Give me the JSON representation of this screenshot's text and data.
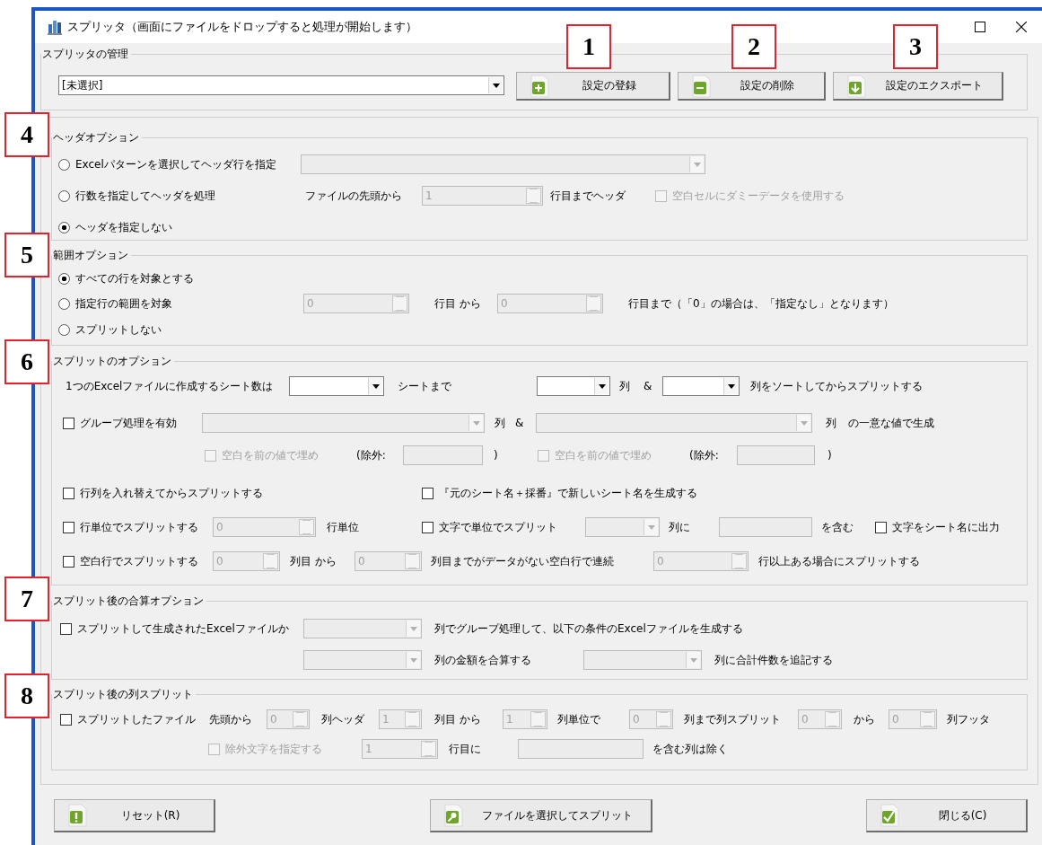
{
  "window": {
    "title": "スプリッタ（画面にファイルをドロップすると処理が開始します）"
  },
  "management": {
    "legend": "スプリッタの管理",
    "combo": {
      "value": "[未選択]"
    },
    "buttons": [
      {
        "label": "設定の登録"
      },
      {
        "label": "設定の削除"
      },
      {
        "label": "設定のエクスポート"
      }
    ]
  },
  "sections": [
    {
      "legend": "ヘッダオプション",
      "rows": [
        {
          "items": [
            {
              "kind": "radio",
              "label": "Excelパターンを選択してヘッダ行を指定",
              "selected": false
            },
            {
              "kind": "combo",
              "disabled": true
            }
          ]
        },
        {
          "items": [
            {
              "kind": "radio",
              "label": "行数を指定してヘッダを処理",
              "selected": false
            },
            {
              "kind": "label",
              "text": "ファイルの先頭から"
            },
            {
              "kind": "spin",
              "value": "1",
              "disabled": true
            },
            {
              "kind": "label",
              "text": "行目までヘッダ"
            },
            {
              "kind": "checkbox",
              "label": "空白セルにダミーデータを使用する",
              "checked": false,
              "disabled": true
            }
          ]
        },
        {
          "items": [
            {
              "kind": "radio",
              "label": "ヘッダを指定しない",
              "selected": true
            }
          ]
        }
      ]
    },
    {
      "legend": "範囲オプション",
      "rows": [
        {
          "items": [
            {
              "kind": "radio",
              "label": "すべての行を対象とする",
              "selected": true
            }
          ]
        },
        {
          "items": [
            {
              "kind": "radio",
              "label": "指定行の範囲を対象",
              "selected": false
            },
            {
              "kind": "spin",
              "value": "0",
              "disabled": true
            },
            {
              "kind": "label",
              "text": "行目 から"
            },
            {
              "kind": "spin",
              "value": "0",
              "disabled": true
            },
            {
              "kind": "label",
              "text": "行目まで（「0」の場合は、「指定なし」となります）"
            }
          ]
        },
        {
          "items": [
            {
              "kind": "radio",
              "label": "スプリットしない",
              "selected": false
            }
          ]
        }
      ]
    },
    {
      "legend": "スプリットのオプション",
      "rows": [
        {
          "items": [
            {
              "kind": "label",
              "text": "1つのExcelファイルに作成するシート数は"
            },
            {
              "kind": "combo",
              "disabled": false
            },
            {
              "kind": "label",
              "text": "シートまで"
            },
            {
              "kind": "combo",
              "disabled": false
            },
            {
              "kind": "label",
              "text": "列"
            },
            {
              "kind": "label",
              "text": "&"
            },
            {
              "kind": "combo",
              "disabled": false
            },
            {
              "kind": "label",
              "text": "列をソートしてからスプリットする"
            }
          ]
        },
        {
          "items": [
            {
              "kind": "checkbox",
              "label": "グループ処理を有効",
              "checked": false,
              "disabled": false
            },
            {
              "kind": "combo",
              "disabled": true
            },
            {
              "kind": "label",
              "text": "列"
            },
            {
              "kind": "label",
              "text": "&"
            },
            {
              "kind": "combo",
              "disabled": true
            },
            {
              "kind": "label",
              "text": "列"
            },
            {
              "kind": "label",
              "text": "の一意な値で生成"
            }
          ]
        },
        {
          "items": [
            {
              "kind": "checkbox",
              "label": "空白を前の値で埋め",
              "checked": false,
              "disabled": true
            },
            {
              "kind": "label",
              "text": "(除外:"
            },
            {
              "kind": "textbox",
              "disabled": true
            },
            {
              "kind": "label",
              "text": ")"
            },
            {
              "kind": "checkbox",
              "label": "空白を前の値で埋め",
              "checked": false,
              "disabled": true
            },
            {
              "kind": "label",
              "text": "(除外:"
            },
            {
              "kind": "textbox",
              "disabled": true
            },
            {
              "kind": "label",
              "text": ")"
            }
          ]
        },
        {
          "items": [
            {
              "kind": "checkbox",
              "label": "行列を入れ替えてからスプリットする",
              "checked": false,
              "disabled": false
            },
            {
              "kind": "checkbox",
              "label": "『元のシート名＋採番』で新しいシート名を生成する",
              "checked": false,
              "disabled": false
            }
          ]
        },
        {
          "items": [
            {
              "kind": "checkbox",
              "label": "行単位でスプリットする",
              "checked": false,
              "disabled": false
            },
            {
              "kind": "spin",
              "value": "0",
              "disabled": true
            },
            {
              "kind": "label",
              "text": "行単位"
            },
            {
              "kind": "checkbox",
              "label": "文字で単位でスプリット",
              "checked": false,
              "disabled": false
            },
            {
              "kind": "combo",
              "disabled": true
            },
            {
              "kind": "label",
              "text": "列に"
            },
            {
              "kind": "textbox",
              "disabled": true
            },
            {
              "kind": "label",
              "text": "を含む"
            },
            {
              "kind": "checkbox",
              "label": "文字をシート名に出力",
              "checked": false,
              "disabled": false
            }
          ]
        },
        {
          "items": [
            {
              "kind": "checkbox",
              "label": "空白行でスプリットする",
              "checked": false,
              "disabled": false
            },
            {
              "kind": "spin",
              "value": "0",
              "disabled": true
            },
            {
              "kind": "label",
              "text": "列目 から"
            },
            {
              "kind": "spin",
              "value": "0",
              "disabled": true
            },
            {
              "kind": "label",
              "text": "列目までがデータがない空白行で連続"
            },
            {
              "kind": "spin",
              "value": "0",
              "disabled": true
            },
            {
              "kind": "label",
              "text": "行以上ある場合にスプリットする"
            }
          ]
        }
      ]
    },
    {
      "legend": "スプリット後の合算オプション",
      "rows": [
        {
          "items": [
            {
              "kind": "checkbox",
              "label": "スプリットして生成されたExcelファイルか",
              "checked": false,
              "disabled": false
            },
            {
              "kind": "combo",
              "disabled": true
            },
            {
              "kind": "label",
              "text": "列でグループ処理して、以下の条件のExcelファイルを生成する"
            }
          ]
        },
        {
          "items": [
            {
              "kind": "combo",
              "disabled": true
            },
            {
              "kind": "label",
              "text": "列の金額を合算する"
            },
            {
              "kind": "combo",
              "disabled": true
            },
            {
              "kind": "label",
              "text": "列に合計件数を追記する"
            }
          ]
        }
      ]
    },
    {
      "legend": "スプリット後の列スプリット",
      "rows": [
        {
          "items": [
            {
              "kind": "checkbox",
              "label": "スプリットしたファイル",
              "checked": false,
              "disabled": false
            },
            {
              "kind": "label",
              "text": "先頭から"
            },
            {
              "kind": "spin",
              "value": "0",
              "disabled": true
            },
            {
              "kind": "label",
              "text": "列ヘッダ"
            },
            {
              "kind": "spin",
              "value": "1",
              "disabled": true
            },
            {
              "kind": "label",
              "text": "列目 から"
            },
            {
              "kind": "spin",
              "value": "1",
              "disabled": true
            },
            {
              "kind": "label",
              "text": "列単位で"
            },
            {
              "kind": "spin",
              "value": "0",
              "disabled": true
            },
            {
              "kind": "label",
              "text": "列まで列スプリット"
            },
            {
              "kind": "spin",
              "value": "0",
              "disabled": true
            },
            {
              "kind": "label",
              "text": "から"
            },
            {
              "kind": "spin",
              "value": "0",
              "disabled": true
            },
            {
              "kind": "label",
              "text": "列フッタ"
            }
          ]
        },
        {
          "items": [
            {
              "kind": "checkbox",
              "label": "除外文字を指定する",
              "checked": false,
              "disabled": true
            },
            {
              "kind": "spin",
              "value": "1",
              "disabled": true
            },
            {
              "kind": "label",
              "text": "行目に"
            },
            {
              "kind": "textbox",
              "disabled": true
            },
            {
              "kind": "label",
              "text": "を含む列は除く"
            }
          ]
        }
      ]
    }
  ],
  "buttons": [
    {
      "label": "リセット(R)"
    },
    {
      "label": "ファイルを選択してスプリット"
    },
    {
      "label": "閉じる(C)"
    }
  ],
  "callouts": [
    {
      "label": "1"
    },
    {
      "label": "2"
    },
    {
      "label": "3"
    },
    {
      "label": "4"
    },
    {
      "label": "5"
    },
    {
      "label": "6"
    },
    {
      "label": "7"
    },
    {
      "label": "8"
    }
  ]
}
